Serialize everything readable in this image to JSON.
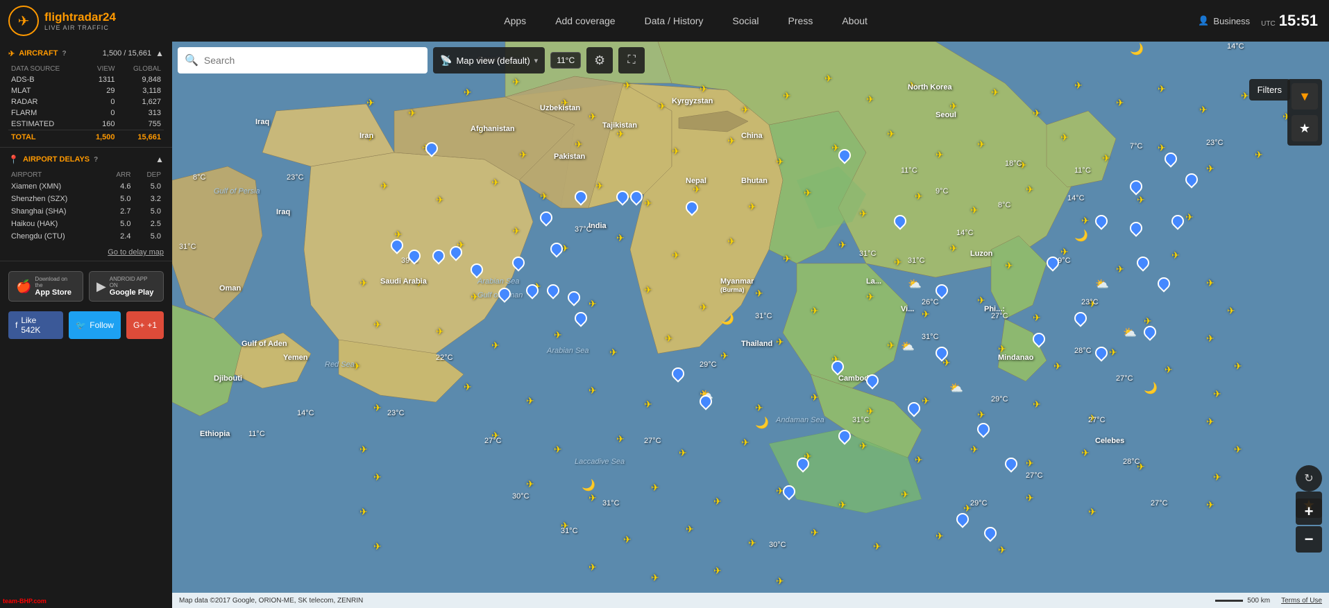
{
  "header": {
    "logo_main": "flightradar24",
    "logo_sub": "LIVE AIR TRAFFIC",
    "nav": [
      {
        "label": "Apps"
      },
      {
        "label": "Add coverage"
      },
      {
        "label": "Data / History"
      },
      {
        "label": "Social"
      },
      {
        "label": "Press"
      },
      {
        "label": "About"
      }
    ],
    "user_label": "Business",
    "utc_label": "UTC",
    "time": "15:51"
  },
  "sidebar": {
    "aircraft_title": "AIRCRAFT",
    "aircraft_help": "?",
    "aircraft_count": "1,500 / 15,661",
    "data_source_header": "DATA SOURCE",
    "view_header": "VIEW",
    "global_header": "GLOBAL",
    "rows": [
      {
        "source": "ADS-B",
        "view": "1311",
        "global": "9,848"
      },
      {
        "source": "MLAT",
        "view": "29",
        "global": "3,118"
      },
      {
        "source": "RADAR",
        "view": "0",
        "global": "1,627"
      },
      {
        "source": "FLARM",
        "view": "0",
        "global": "313"
      },
      {
        "source": "ESTIMATED",
        "view": "160",
        "global": "755"
      },
      {
        "source": "TOTAL",
        "view": "1,500",
        "global": "15,661"
      }
    ],
    "delays_title": "AIRPORT DELAYS",
    "delays_help": "?",
    "delay_headers": [
      "AIRPORT",
      "ARR",
      "DEP"
    ],
    "delay_rows": [
      {
        "airport": "Xiamen (XMN)",
        "arr": "4.6",
        "dep": "5.0"
      },
      {
        "airport": "Shenzhen (SZX)",
        "arr": "5.0",
        "dep": "3.2"
      },
      {
        "airport": "Shanghai (SHA)",
        "arr": "2.7",
        "dep": "5.0"
      },
      {
        "airport": "Haikou (HAK)",
        "arr": "5.0",
        "dep": "2.5"
      },
      {
        "airport": "Chengdu (CTU)",
        "arr": "2.4",
        "dep": "5.0"
      }
    ],
    "go_to_delay_label": "Go to delay map",
    "app_store_sub": "Download on the",
    "app_store_name": "App Store",
    "google_play_sub": "ANDROID APP ON",
    "google_play_name": "Google Play",
    "fb_like": "Like 542K",
    "tw_follow": "Follow",
    "gp_plus": "+1",
    "watermark": "team-BHP.com"
  },
  "map": {
    "search_placeholder": "Search",
    "map_view_label": "Map view (default)",
    "filters_label": "Filters",
    "attribution": "Map data ©2017 Google, ORION-ME, SK telecom, ZENRIN",
    "scale": "500 km",
    "terms": "Terms of Use",
    "zoom_in": "+",
    "zoom_out": "−",
    "temp_badge": "11°C"
  }
}
